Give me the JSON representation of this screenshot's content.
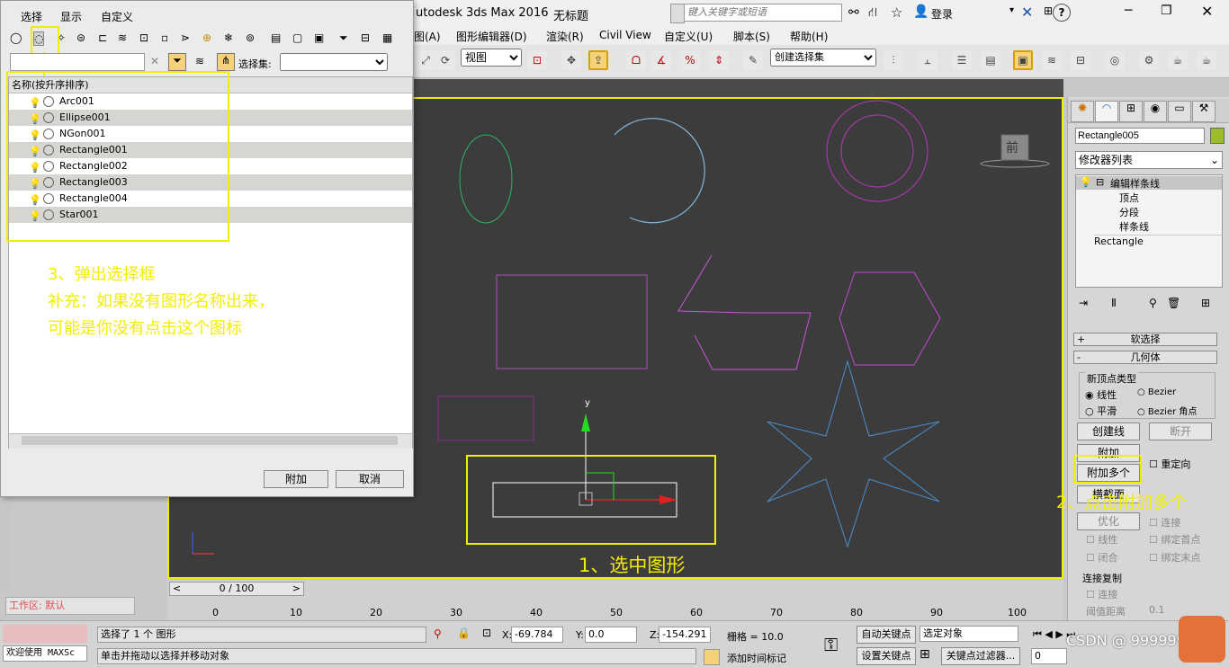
{
  "app": {
    "title": "utodesk 3ds Max 2016",
    "doc": "无标题",
    "search_placeholder": "键入关键字或短语",
    "login": "登录"
  },
  "menubar": [
    "图(A)",
    "图形编辑器(D)",
    "渲染(R)",
    "Civil View",
    "自定义(U)",
    "脚本(S)",
    "帮助(H)"
  ],
  "toolbar": {
    "view_dropdown": "视图",
    "selection_set": "创建选择集"
  },
  "viewport": {
    "cube_label": "前"
  },
  "dialog": {
    "menu": [
      "选择",
      "显示",
      "自定义"
    ],
    "selection_set_label": "选择集:",
    "column_header": "名称(按升序排序)",
    "items": [
      "Arc001",
      "Ellipse001",
      "NGon001",
      "Rectangle001",
      "Rectangle002",
      "Rectangle003",
      "Rectangle004",
      "Star001"
    ],
    "attach_button": "附加",
    "cancel_button": "取消"
  },
  "annotations": {
    "step1": "1、选中图形",
    "step2": "2、点击附加多个",
    "step3": "3、弹出选择框",
    "note1": "补充：如果没有图形名称出来，",
    "note2": "可能是你没有点击这个图标"
  },
  "cmdpanel": {
    "object_name": "Rectangle005",
    "modifier_list": "修改器列表",
    "stack_top": "编辑样条线",
    "stack_sub": [
      "顶点",
      "分段",
      "样条线"
    ],
    "stack_base": "Rectangle",
    "rollout_soft": "软选择",
    "rollout_geometry": "几何体",
    "new_vertex_type": "新顶点类型",
    "radio_linear": "线性",
    "radio_bezier": "Bezier",
    "radio_smooth": "平滑",
    "radio_bezier_corner": "Bezier 角点",
    "create_line": "创建线",
    "break": "断开",
    "attach": "附加",
    "reorient": "重定向",
    "attach_multiple": "附加多个",
    "cross_section": "横截面",
    "optimize": "优化",
    "connect": "连接",
    "linear": "线性",
    "bind_first": "绑定首点",
    "closed": "闭合",
    "bind_last": "绑定末点",
    "connect_copy": "连接复制",
    "connect2": "连接",
    "threshold": "阈值距离",
    "threshold_val": "0.1"
  },
  "timeline": {
    "counter": "0 / 100",
    "ticks": [
      "0",
      "10",
      "20",
      "30",
      "40",
      "50",
      "60",
      "70",
      "80",
      "90",
      "100"
    ]
  },
  "status": {
    "left_panel": "欢迎使用 MAXSc",
    "workspace": "工作区: 默认",
    "selected": "选择了 1 个 图形",
    "prompt": "单击并拖动以选择并移动对象",
    "x_label": "X:",
    "x": "-69.784",
    "y_label": "Y:",
    "y": "0.0",
    "z_label": "Z:",
    "z": "-154.291",
    "grid": "栅格 = 10.0",
    "auto_key": "自动关键点",
    "selected_obj": "选定对象",
    "set_key": "设置关键点",
    "key_filter": "关键点过滤器...",
    "add_time_tag": "添加时间标记",
    "frame": "0",
    "watermark": "CSDN @ 999999"
  }
}
